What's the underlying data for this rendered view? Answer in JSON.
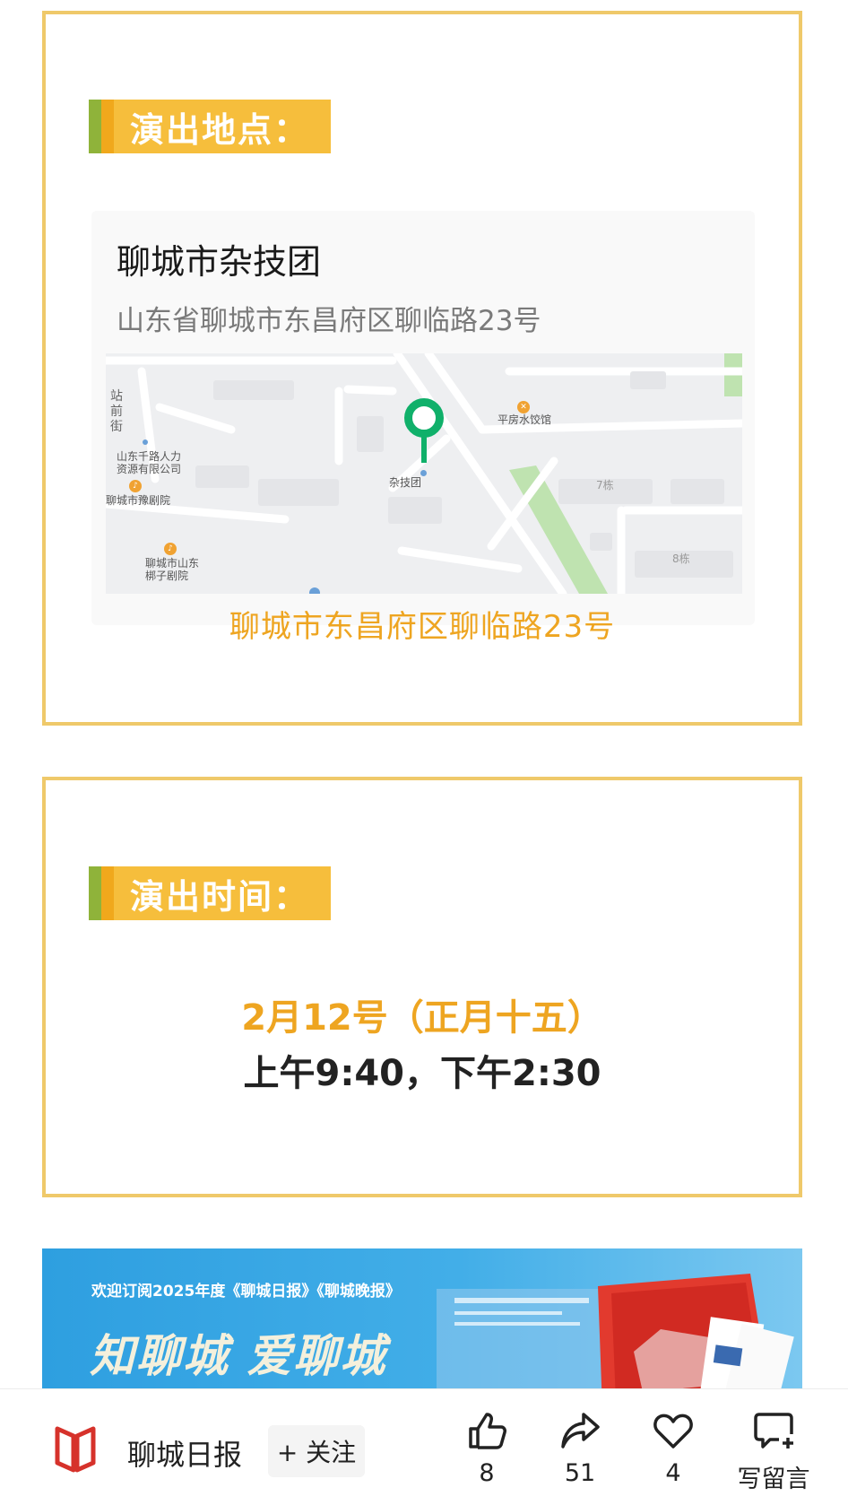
{
  "venue": {
    "section_title": "演出地点：",
    "place_name": "聊城市杂技团",
    "place_address": "山东省聊城市东昌府区聊临路23号",
    "map_labels": {
      "station_street": "站前街",
      "company": "山东千路人力资源有限公司",
      "theater1": "聊城市豫剧院",
      "theater2": "聊城市山东梆子剧院",
      "restaurant": "平房水饺馆",
      "pin_label": "杂技团",
      "bldg7": "7栋",
      "bldg8": "8栋"
    },
    "address_link": "聊城市东昌府区聊临路23号"
  },
  "time": {
    "section_title": "演出时间：",
    "date": "2月12号（正月十五）",
    "sessions": "上午9:40，下午2:30"
  },
  "banner": {
    "subtitle": "欢迎订阅2025年度《聊城日报》《聊城晚报》",
    "title": "知聊城 爱聊城"
  },
  "bottom_bar": {
    "brand_name": "聊城日报",
    "follow_label": "+ 关注",
    "like_count": "8",
    "share_count": "51",
    "favorite_count": "4",
    "comment_label": "写留言"
  },
  "colors": {
    "accent_yellow": "#eea521",
    "border_yellow": "#efc96a",
    "tag_green": "#8fb33a",
    "pin_green": "#10b06a",
    "banner_blue": "#2e9fe0"
  }
}
